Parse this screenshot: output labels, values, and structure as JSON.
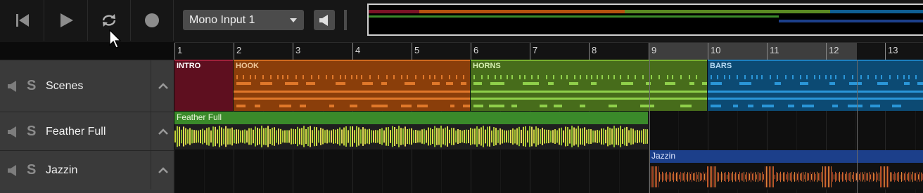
{
  "transport": {
    "icons": [
      "skip-back-icon",
      "play-icon",
      "loop-icon",
      "record-icon"
    ]
  },
  "input_select": {
    "value": "Mono Input 1"
  },
  "ruler": {
    "bars": [
      "1",
      "2",
      "3",
      "4",
      "5",
      "6",
      "7",
      "8",
      "9",
      "10",
      "11",
      "12",
      "13"
    ]
  },
  "tracks": [
    {
      "name": "Scenes",
      "solo": "S"
    },
    {
      "name": "Feather Full",
      "solo": "S"
    },
    {
      "name": "Jazzin",
      "solo": "S"
    }
  ],
  "scenes": [
    {
      "label": "INTRO",
      "color": "#7a1326"
    },
    {
      "label": "HOOK",
      "color": "#b5520f"
    },
    {
      "label": "HORNS",
      "color": "#5a8a23"
    },
    {
      "label": "BARS",
      "color": "#0f5f93"
    }
  ],
  "clips": {
    "feather": {
      "label": "Feather Full",
      "color": "#3a8a2a"
    },
    "jazzin": {
      "label": "Jazzin",
      "color": "#1c3f8a"
    }
  },
  "colors": {
    "accent_loop": "#3e3e3e",
    "overview_border": "#d0d0d0"
  }
}
